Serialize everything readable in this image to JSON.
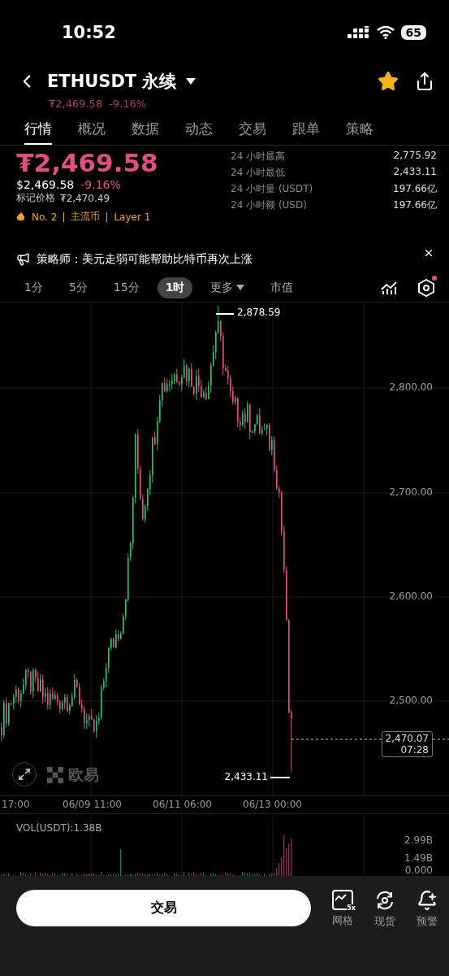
{
  "status_bar": {
    "time": "10:52",
    "battery": "65"
  },
  "header": {
    "title": "ETHUSDT 永续",
    "price": "₮2,469.58",
    "change": "-9.16%",
    "favorite": true
  },
  "tabs": [
    {
      "label": "行情",
      "selected": true
    },
    {
      "label": "概况",
      "selected": false
    },
    {
      "label": "数据",
      "selected": false
    },
    {
      "label": "动态",
      "selected": false
    },
    {
      "label": "交易",
      "selected": false
    },
    {
      "label": "跟单",
      "selected": false
    },
    {
      "label": "策略",
      "selected": false
    }
  ],
  "summary": {
    "price": "₮2,469.58",
    "usd_price": "$2,469.58",
    "change": "-9.16%",
    "mark_price_label": "标记价格",
    "mark_price": "₮2,470.49",
    "tags": [
      "No. 2",
      "主流币",
      "Layer 1"
    ]
  },
  "stats": [
    {
      "label": "24 小时最高",
      "value": "2,775.92"
    },
    {
      "label": "24 小时最低",
      "value": "2,433.11"
    },
    {
      "label": "24 小时量 (USDT)",
      "value": "197.66亿"
    },
    {
      "label": "24 小时额 (USD)",
      "value": "197.66亿"
    }
  ],
  "news": {
    "text": "策略师：美元走弱可能帮助比特币再次上涨"
  },
  "intervals": [
    {
      "label": "1分",
      "selected": false,
      "kind": "plain"
    },
    {
      "label": "5分",
      "selected": false,
      "kind": "plain"
    },
    {
      "label": "15分",
      "selected": false,
      "kind": "plain"
    },
    {
      "label": "1时",
      "selected": true,
      "kind": "plain"
    },
    {
      "label": "更多",
      "selected": false,
      "kind": "dropdown"
    },
    {
      "label": "市值",
      "selected": false,
      "kind": "plain"
    }
  ],
  "settings_badge": true,
  "chart": {
    "y_labels": [
      "2,800.00",
      "2,700.00",
      "2,600.00",
      "2,500.00"
    ],
    "x_labels": [
      "17:00",
      "06/09 11:00",
      "06/11 06:00",
      "06/13 00:00"
    ],
    "high": "2,878.59",
    "low": "2,433.11",
    "last_price": "2,470.07",
    "countdown": "07:28",
    "watermark": "欧易"
  },
  "volume": {
    "label": "VOL(USDT):1.38B",
    "y_labels": [
      "2.99B",
      "1.49B",
      "0.000"
    ]
  },
  "bottom_bar": {
    "trade_button": "交易",
    "actions": [
      {
        "label": "网格",
        "kind": "grid",
        "badge": "5x"
      },
      {
        "label": "现货",
        "kind": "spot"
      },
      {
        "label": "预警",
        "kind": "alert"
      }
    ]
  }
}
